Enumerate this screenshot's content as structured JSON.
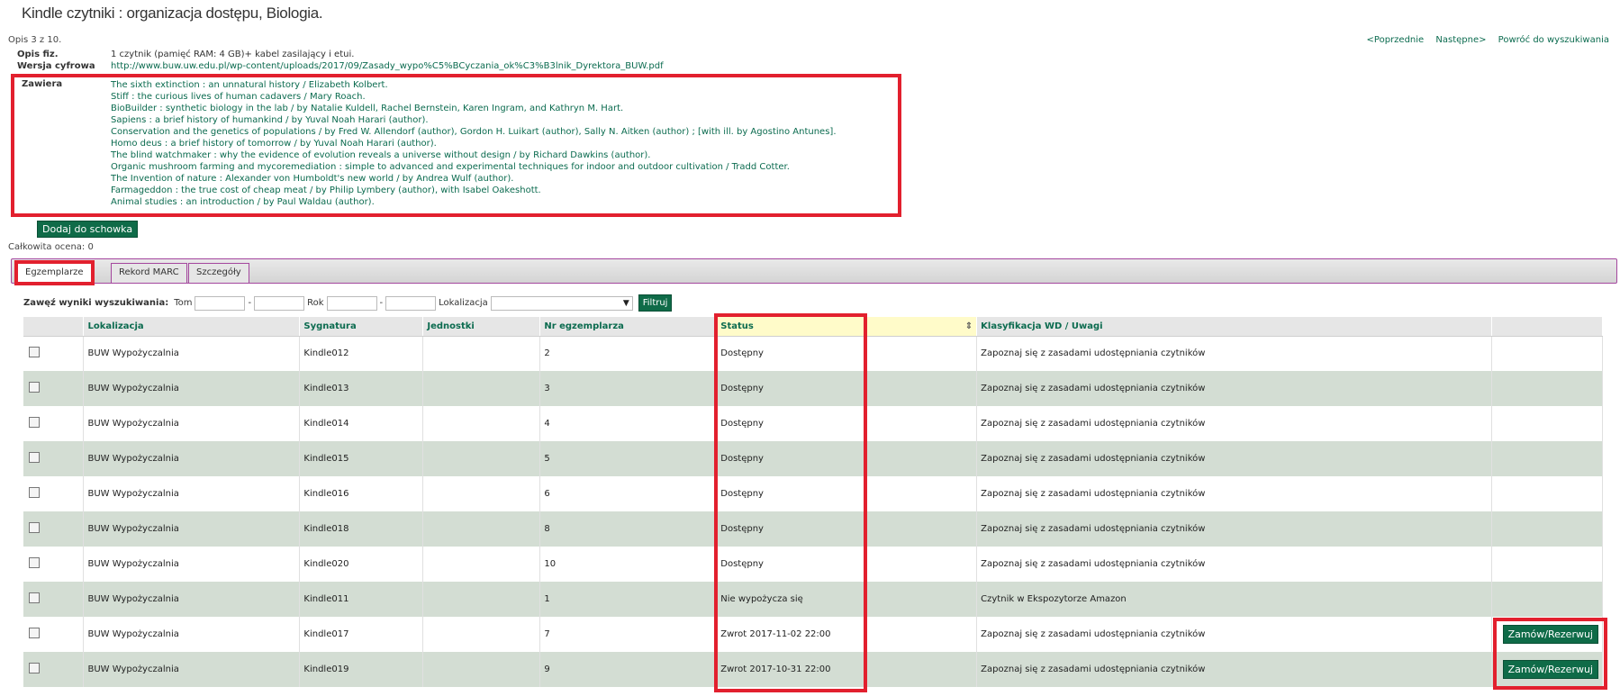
{
  "page_title": "Kindle czytniki : organizacja dostępu, Biologia.",
  "record_counter": "Opis 3 z 10.",
  "nav": {
    "prev": "<Poprzednie",
    "next": "Następne>",
    "back": "Powróć do wyszukiwania"
  },
  "meta": {
    "opis_label": "Opis fiz.",
    "opis_value": "1 czytnik (pamięć RAM: 4 GB)+ kabel zasilający i etui.",
    "wersja_label": "Wersja cyfrowa",
    "wersja_value": "http://www.buw.uw.edu.pl/wp-content/uploads/2017/09/Zasady_wypo%C5%BCyczania_ok%C3%B3lnik_Dyrektora_BUW.pdf",
    "zawiera_label": "Zawiera",
    "zawiera_items": [
      "The sixth extinction : an unnatural history / Elizabeth Kolbert.",
      "Stiff : the curious lives of human cadavers / Mary Roach.",
      "BioBuilder : synthetic biology in the lab / by Natalie Kuldell, Rachel Bernstein, Karen Ingram, and Kathryn M. Hart.",
      "Sapiens : a brief history of humankind / by Yuval Noah Harari (author).",
      "Conservation and the genetics of populations / by Fred W. Allendorf (author), Gordon H. Luikart (author), Sally N. Aitken (author) ; [with ill. by Agostino Antunes].",
      "Homo deus : a brief history of tomorrow / by Yuval Noah Harari (author).",
      "The blind watchmaker : why the evidence of evolution reveals a universe without design / by Richard Dawkins (author).",
      "Organic mushroom farming and mycoremediation : simple to advanced and experimental techniques for indoor and outdoor cultivation / Tradd Cotter.",
      "The Invention of nature : Alexander von Humboldt's new world / by Andrea Wulf (author).",
      "Farmageddon : the true cost of cheap meat / by Philip Lymbery (author), with Isabel Oakeshott.",
      "Animal studies : an introduction / by Paul Waldau (author)."
    ]
  },
  "add_to_clipboard": "Dodaj do schowka",
  "rating": "Całkowita ocena: 0",
  "tabs": [
    "Egzemplarze",
    "Rekord MARC",
    "Szczegóły"
  ],
  "filter": {
    "label": "Zawęź wyniki wyszukiwania:",
    "tom": "Tom",
    "dash": "-",
    "rok": "Rok",
    "lokalizacja": "Lokalizacja",
    "button": "Filtruj"
  },
  "table": {
    "headers": [
      "Lokalizacja",
      "Sygnatura",
      "Jednostki",
      "Nr egzemplarza",
      "Status",
      "Klasyfikacja WD / Uwagi"
    ],
    "sort_icon": "⇕",
    "rows": [
      {
        "lok": "BUW Wypożyczalnia",
        "syg": "Kindle012",
        "jed": "",
        "nr": "2",
        "status": "Dostępny",
        "uwagi": "Zapoznaj się z zasadami udostępniania czytników",
        "order": ""
      },
      {
        "lok": "BUW Wypożyczalnia",
        "syg": "Kindle013",
        "jed": "",
        "nr": "3",
        "status": "Dostępny",
        "uwagi": "Zapoznaj się z zasadami udostępniania czytników",
        "order": ""
      },
      {
        "lok": "BUW Wypożyczalnia",
        "syg": "Kindle014",
        "jed": "",
        "nr": "4",
        "status": "Dostępny",
        "uwagi": "Zapoznaj się z zasadami udostępniania czytników",
        "order": ""
      },
      {
        "lok": "BUW Wypożyczalnia",
        "syg": "Kindle015",
        "jed": "",
        "nr": "5",
        "status": "Dostępny",
        "uwagi": "Zapoznaj się z zasadami udostępniania czytników",
        "order": ""
      },
      {
        "lok": "BUW Wypożyczalnia",
        "syg": "Kindle016",
        "jed": "",
        "nr": "6",
        "status": "Dostępny",
        "uwagi": "Zapoznaj się z zasadami udostępniania czytników",
        "order": ""
      },
      {
        "lok": "BUW Wypożyczalnia",
        "syg": "Kindle018",
        "jed": "",
        "nr": "8",
        "status": "Dostępny",
        "uwagi": "Zapoznaj się z zasadami udostępniania czytników",
        "order": ""
      },
      {
        "lok": "BUW Wypożyczalnia",
        "syg": "Kindle020",
        "jed": "",
        "nr": "10",
        "status": "Dostępny",
        "uwagi": "Zapoznaj się z zasadami udostępniania czytników",
        "order": ""
      },
      {
        "lok": "BUW Wypożyczalnia",
        "syg": "Kindle011",
        "jed": "",
        "nr": "1",
        "status": "Nie wypożycza się",
        "uwagi": "Czytnik w Ekspozytorze Amazon",
        "order": ""
      },
      {
        "lok": "BUW Wypożyczalnia",
        "syg": "Kindle017",
        "jed": "",
        "nr": "7",
        "status": "Zwrot 2017-11-02 22:00",
        "uwagi": "Zapoznaj się z zasadami udostępniania czytników",
        "order": "Zamów/Rezerwuj"
      },
      {
        "lok": "BUW Wypożyczalnia",
        "syg": "Kindle019",
        "jed": "",
        "nr": "9",
        "status": "Zwrot 2017-10-31 22:00",
        "uwagi": "Zapoznaj się z zasadami udostępniania czytników",
        "order": "Zamów/Rezerwuj"
      }
    ]
  },
  "colors": {
    "link_green": "#0b6b4f",
    "button_green": "#0f6b48",
    "highlight_red": "#e2202e",
    "row_alt": "#d3ddd3",
    "tab_border": "#a4479e"
  }
}
